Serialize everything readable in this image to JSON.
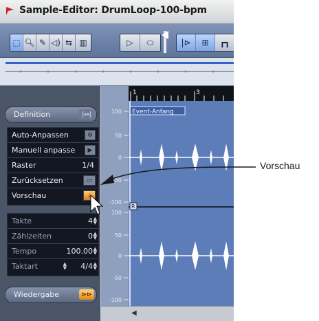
{
  "window": {
    "title": "Sample-Editor: DrumLoop-100-bpm"
  },
  "toolbar": {
    "icons": [
      "range-select-icon",
      "zoom-icon",
      "pencil-icon",
      "audition-icon",
      "scrub-icon",
      "grid-icon",
      "play-icon",
      "loop-icon",
      "marker-icon",
      "snap-icon",
      "fit-icon",
      "edge-icon"
    ]
  },
  "ruler": {
    "bar1": "1",
    "bar3": "3",
    "event_start": "Event-Anfang",
    "region_marker": "R"
  },
  "scale": {
    "top": [
      "100",
      "50",
      "0",
      "-50",
      "-100"
    ],
    "bottom": [
      "100",
      "50",
      "0",
      "-50",
      "-100"
    ]
  },
  "definition": {
    "header": "Definition",
    "header_btn": "|↔|",
    "items": [
      {
        "label": "Auto-Anpassen"
      },
      {
        "label": "Manuell anpasse"
      },
      {
        "label": "Raster",
        "value": "1/4"
      },
      {
        "label": "Zurücksetzen"
      },
      {
        "label": "Vorschau"
      }
    ],
    "fields": [
      {
        "label": "Takte",
        "value": "4"
      },
      {
        "label": "Zählzeiten",
        "value": "0"
      },
      {
        "label": "Tempo",
        "value": "100.00"
      },
      {
        "label": "Taktart",
        "value": "4/4"
      }
    ]
  },
  "playback": {
    "header": "Wiedergabe"
  },
  "callout": {
    "label": "Vorschau"
  }
}
